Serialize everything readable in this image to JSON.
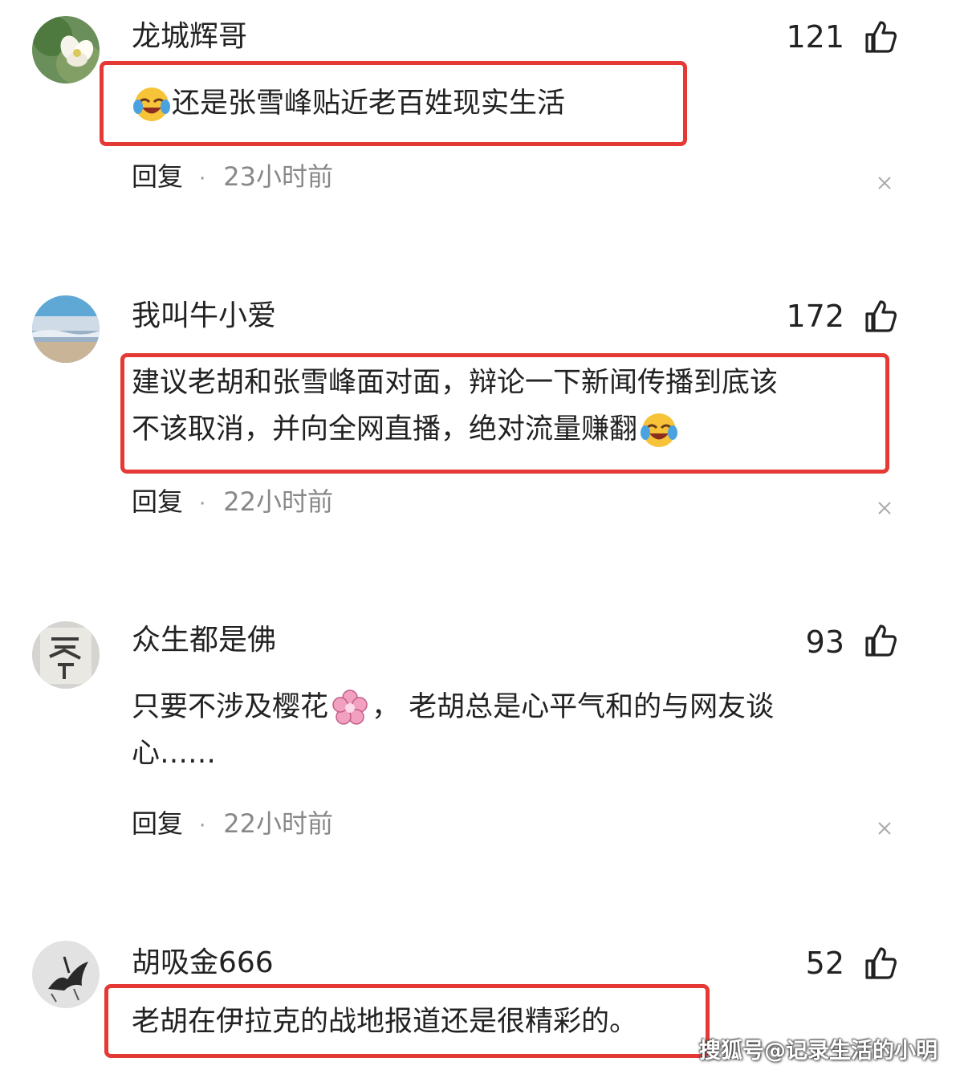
{
  "comments": [
    {
      "username": "龙城辉哥",
      "likes": "121",
      "text_lines": [
        "还是张雪峰贴近老百姓现实生活"
      ],
      "reply_label": "回复",
      "time": "23小时前"
    },
    {
      "username": "我叫牛小爱",
      "likes": "172",
      "text_lines": [
        "建议老胡和张雪峰面对面，辩论一下新闻传播到底该",
        "不该取消，并向全网直播，绝对流量赚翻"
      ],
      "reply_label": "回复",
      "time": "22小时前"
    },
    {
      "username": "众生都是佛",
      "likes": "93",
      "text_lines": [
        "只要不涉及樱花",
        "， 老胡总是心平气和的与网友谈",
        "心……"
      ],
      "reply_label": "回复",
      "time": "22小时前"
    },
    {
      "username": "胡吸金666",
      "likes": "52",
      "text_lines": [
        "老胡在伊拉克的战地报道还是很精彩的。"
      ]
    }
  ],
  "watermark": "搜狐号@记录生活的小明",
  "icons": {
    "like": "thumbs-up-icon",
    "close": "close-icon",
    "emoji_laugh": "laughing-crying-emoji-icon",
    "emoji_flower": "cherry-blossom-emoji-icon"
  },
  "colors": {
    "highlight_border": "#e53935",
    "text": "#222222",
    "meta_time": "#888888"
  }
}
